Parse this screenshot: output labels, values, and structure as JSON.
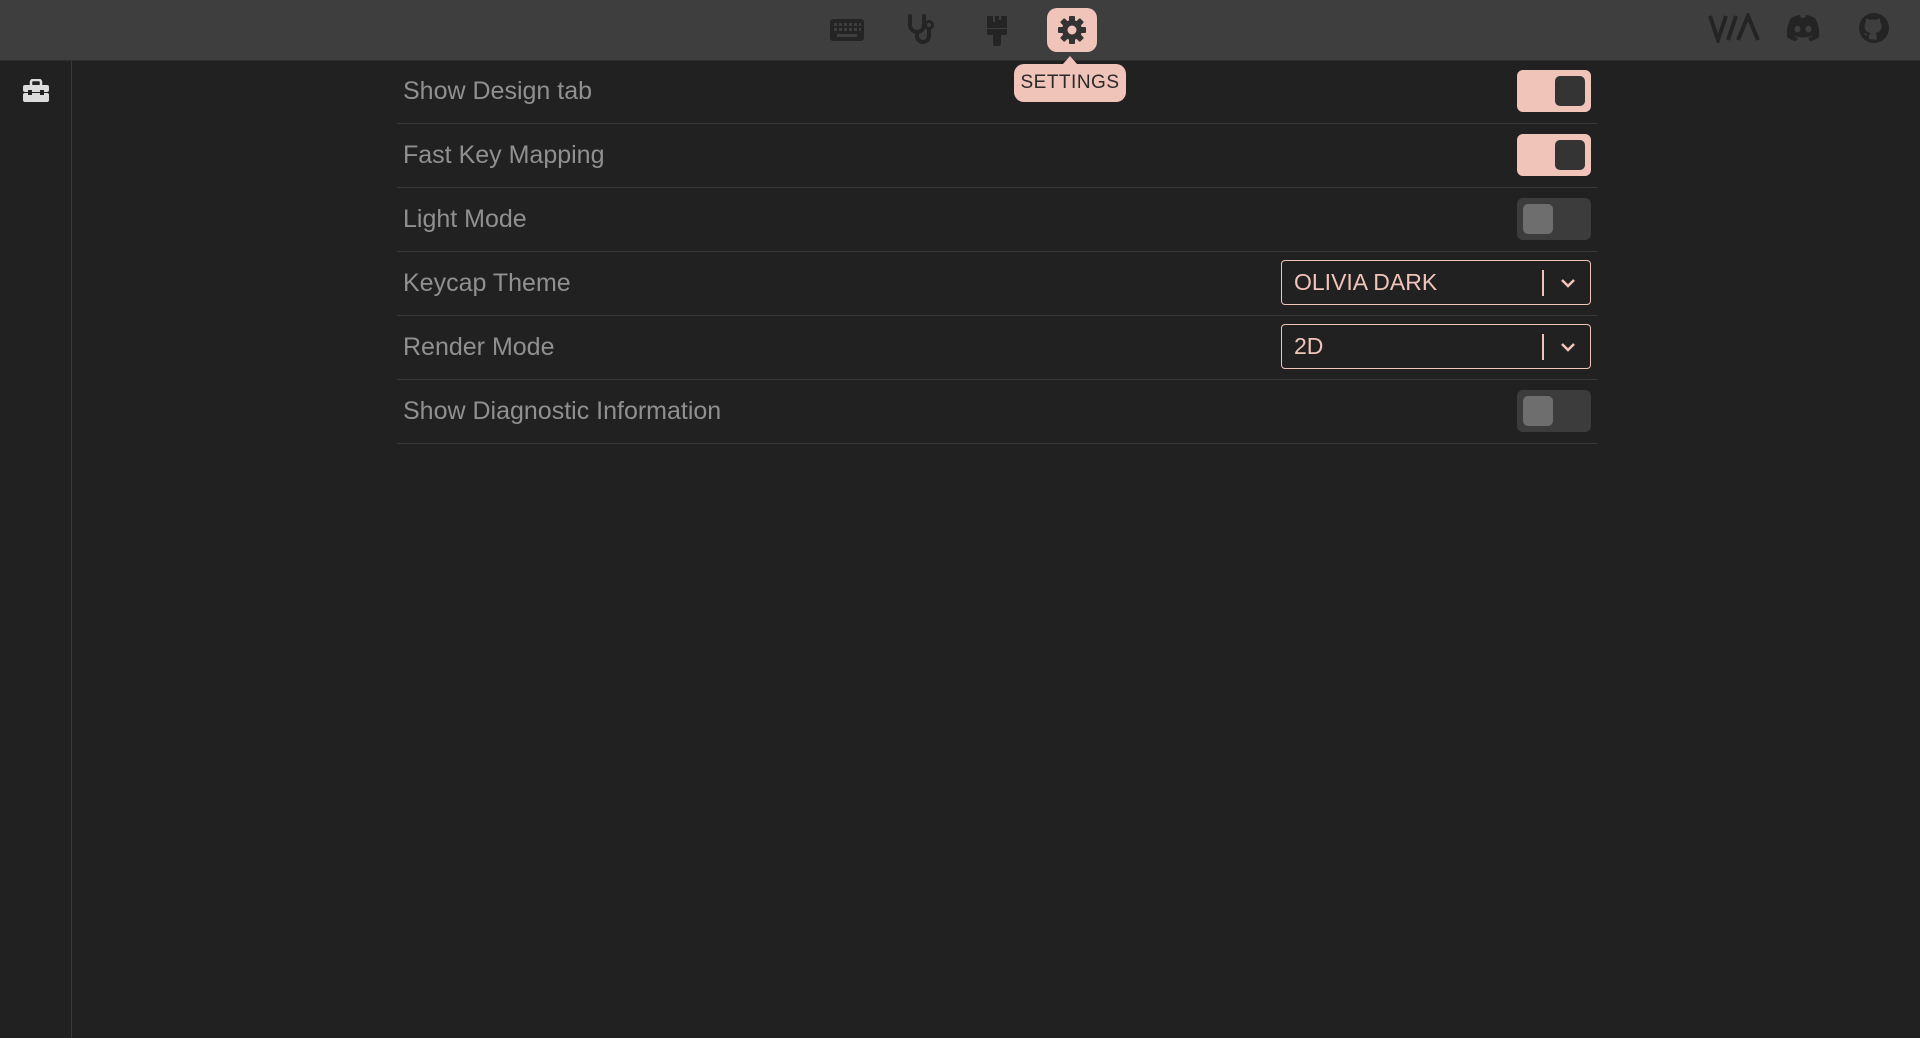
{
  "topbar": {
    "nav": [
      {
        "icon": "keyboard-icon",
        "label": ""
      },
      {
        "icon": "stethoscope-icon",
        "label": ""
      },
      {
        "icon": "paintbrush-icon",
        "label": ""
      },
      {
        "icon": "gear-icon",
        "label": "SETTINGS",
        "active": true
      }
    ],
    "tooltip": "SETTINGS",
    "brand_logo": "VIA",
    "right_icons": [
      "via-logo",
      "discord-icon",
      "github-icon"
    ]
  },
  "sidebar": {
    "icon": "toolbox-icon"
  },
  "settings": {
    "rows": [
      {
        "label": "Show Design tab",
        "type": "toggle",
        "value": true
      },
      {
        "label": "Fast Key Mapping",
        "type": "toggle",
        "value": true
      },
      {
        "label": "Light Mode",
        "type": "toggle",
        "value": false
      },
      {
        "label": "Keycap Theme",
        "type": "select",
        "value": "OLIVIA DARK"
      },
      {
        "label": "Render Mode",
        "type": "select",
        "value": "2D"
      },
      {
        "label": "Show Diagnostic Information",
        "type": "toggle",
        "value": false
      }
    ]
  },
  "colors": {
    "accent": "#f0c4b8",
    "background": "#222122",
    "topbar": "#3e3e3e",
    "label": "#909090"
  }
}
